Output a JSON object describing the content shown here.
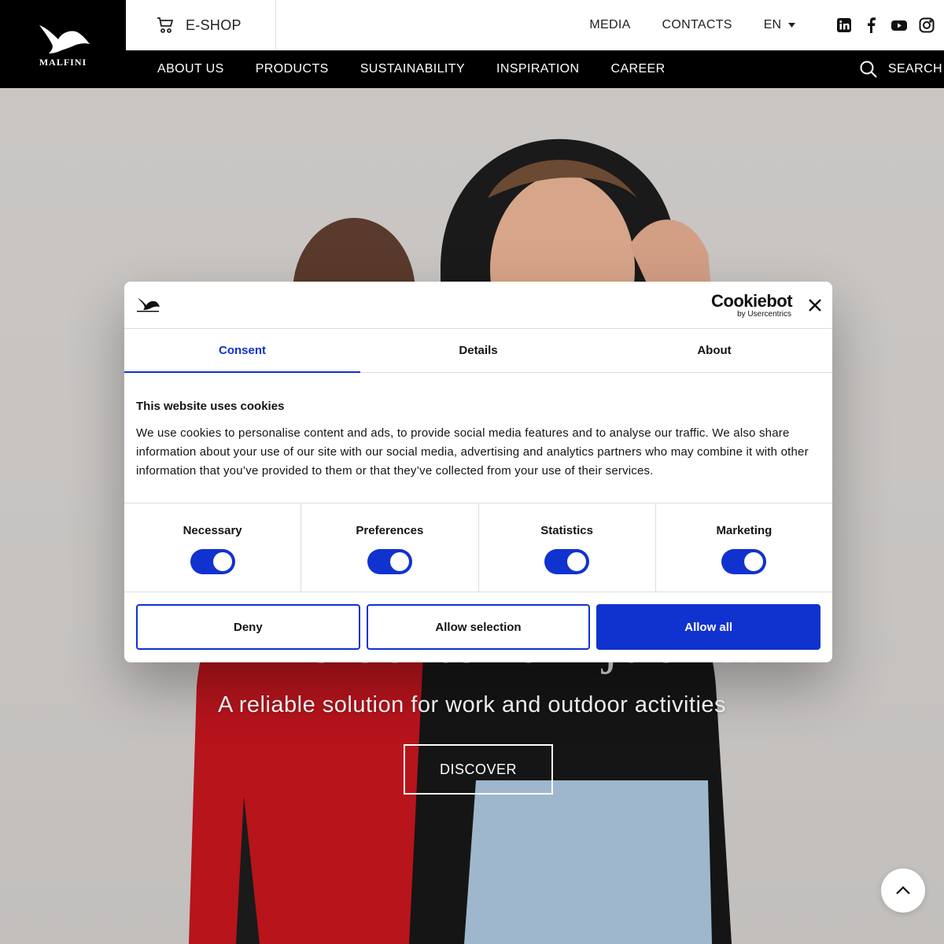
{
  "brand": {
    "logo_text": "MALFINI"
  },
  "topbar": {
    "eshop_label": "E-SHOP",
    "links": [
      "MEDIA",
      "CONTACTS"
    ],
    "language": "EN"
  },
  "nav": {
    "items": [
      "ABOUT US",
      "PRODUCTS",
      "SUSTAINABILITY",
      "INSPIRATION",
      "CAREER"
    ],
    "search_label": "SEARCH"
  },
  "hero": {
    "title": "Prime softshell jacket",
    "subtitle": "A reliable solution for work and outdoor activities",
    "cta": "DISCOVER"
  },
  "cookie_dialog": {
    "provider_main": "Cookiebot",
    "provider_sub": "by Usercentrics",
    "tabs": [
      "Consent",
      "Details",
      "About"
    ],
    "heading": "This website uses cookies",
    "body": "We use cookies to personalise content and ads, to provide social media features and to analyse our traffic. We also share information about your use of our site with our social media, advertising and analytics partners who may combine it with other information that you’ve provided to them or that they’ve collected from your use of their services.",
    "categories": [
      "Necessary",
      "Preferences",
      "Statistics",
      "Marketing"
    ],
    "buttons": {
      "deny": "Deny",
      "allow_selection": "Allow selection",
      "allow_all": "Allow all"
    }
  },
  "colors": {
    "accent": "#1032cf",
    "header_bg": "#000000"
  }
}
